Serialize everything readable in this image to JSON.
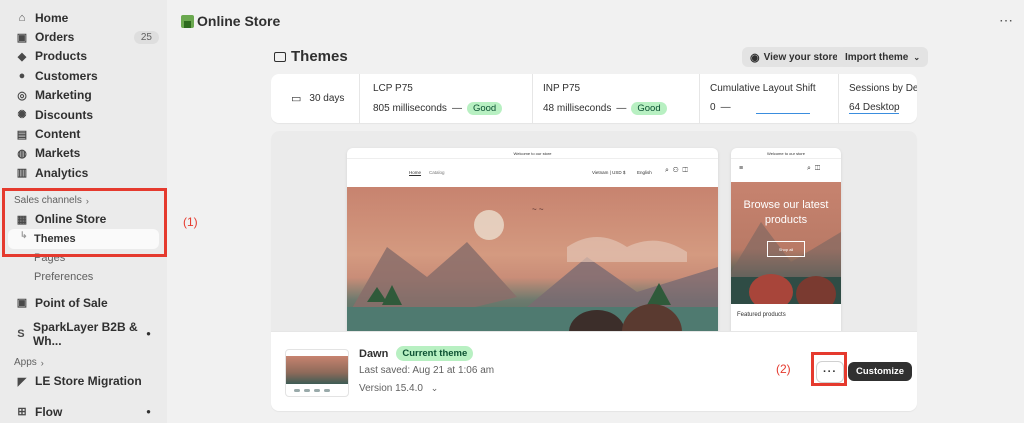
{
  "sidebar": {
    "items": [
      {
        "label": "Home",
        "icon": "home-icon"
      },
      {
        "label": "Orders",
        "icon": "inbox-icon",
        "badge": "25"
      },
      {
        "label": "Products",
        "icon": "tag-icon"
      },
      {
        "label": "Customers",
        "icon": "person-icon"
      },
      {
        "label": "Marketing",
        "icon": "target-icon"
      },
      {
        "label": "Discounts",
        "icon": "discount-icon"
      },
      {
        "label": "Content",
        "icon": "content-icon"
      },
      {
        "label": "Markets",
        "icon": "globe-icon"
      },
      {
        "label": "Analytics",
        "icon": "chart-icon"
      }
    ],
    "sales_channels_label": "Sales channels",
    "online_store_label": "Online Store",
    "themes_label": "Themes",
    "pages_label": "Pages",
    "preferences_label": "Preferences",
    "point_of_sale_label": "Point of Sale",
    "sparklayer_label": "SparkLayer B2B & Wh...",
    "apps_label": "Apps",
    "le_migration_label": "LE Store Migration",
    "flow_label": "Flow"
  },
  "topbar": {
    "title": "Online Store"
  },
  "page": {
    "title": "Themes",
    "view_store_label": "View your store",
    "import_theme_label": "Import theme"
  },
  "metrics": {
    "range": "30 days",
    "lcp": {
      "label": "LCP P75",
      "value": "805 milliseconds",
      "status": "Good"
    },
    "inp": {
      "label": "INP P75",
      "value": "48 milliseconds",
      "status": "Good"
    },
    "cls": {
      "label": "Cumulative Layout Shift",
      "value": "0"
    },
    "sessions": {
      "label": "Sessions by De",
      "value": "64 Desktop"
    }
  },
  "preview": {
    "announcement": "Welcome to our store",
    "nav_home": "Home",
    "nav_catalog": "Catalog",
    "currency": "Vietnam | USD $",
    "language": "English",
    "mobile_hero_text": "Browse our latest products",
    "mobile_shop_all": "Shop all",
    "featured_products": "Featured products"
  },
  "theme": {
    "name": "Dawn",
    "current_badge": "Current theme",
    "last_saved": "Last saved: Aug 21 at 1:06 am",
    "version": "Version 15.4.0",
    "customize_label": "Customize"
  },
  "annotations": {
    "one": "(1)",
    "two": "(2)"
  },
  "colors": {
    "annotation_red": "#e53a2e",
    "good_green": "#b8f0c2",
    "sidebar_bg": "#ebebeb"
  }
}
